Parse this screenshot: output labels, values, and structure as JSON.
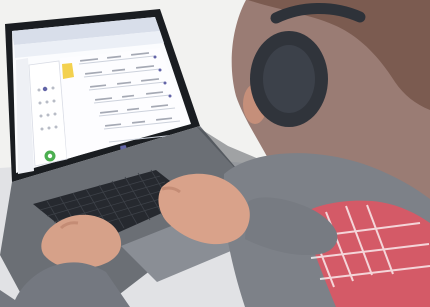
{
  "scene": {
    "subject": "person-wearing-headphones-using-laptop",
    "colors": {
      "wall": "#f2f2f0",
      "desk": "#d9dadd",
      "laptop_body": "#6d7076",
      "keyboard": "#222428",
      "screen_frame": "#111316",
      "screen_ui": "#f7f8fb",
      "accent_purple": "#6264a7",
      "accent_green": "#4caf50",
      "skin": "#d8a38c",
      "sweater": "#7d8188",
      "shirt_red": "#c44a5a",
      "headphones": "#2b2f36"
    }
  },
  "laptop_screen": {
    "app_accent": "purple",
    "call_button_color": "green"
  }
}
